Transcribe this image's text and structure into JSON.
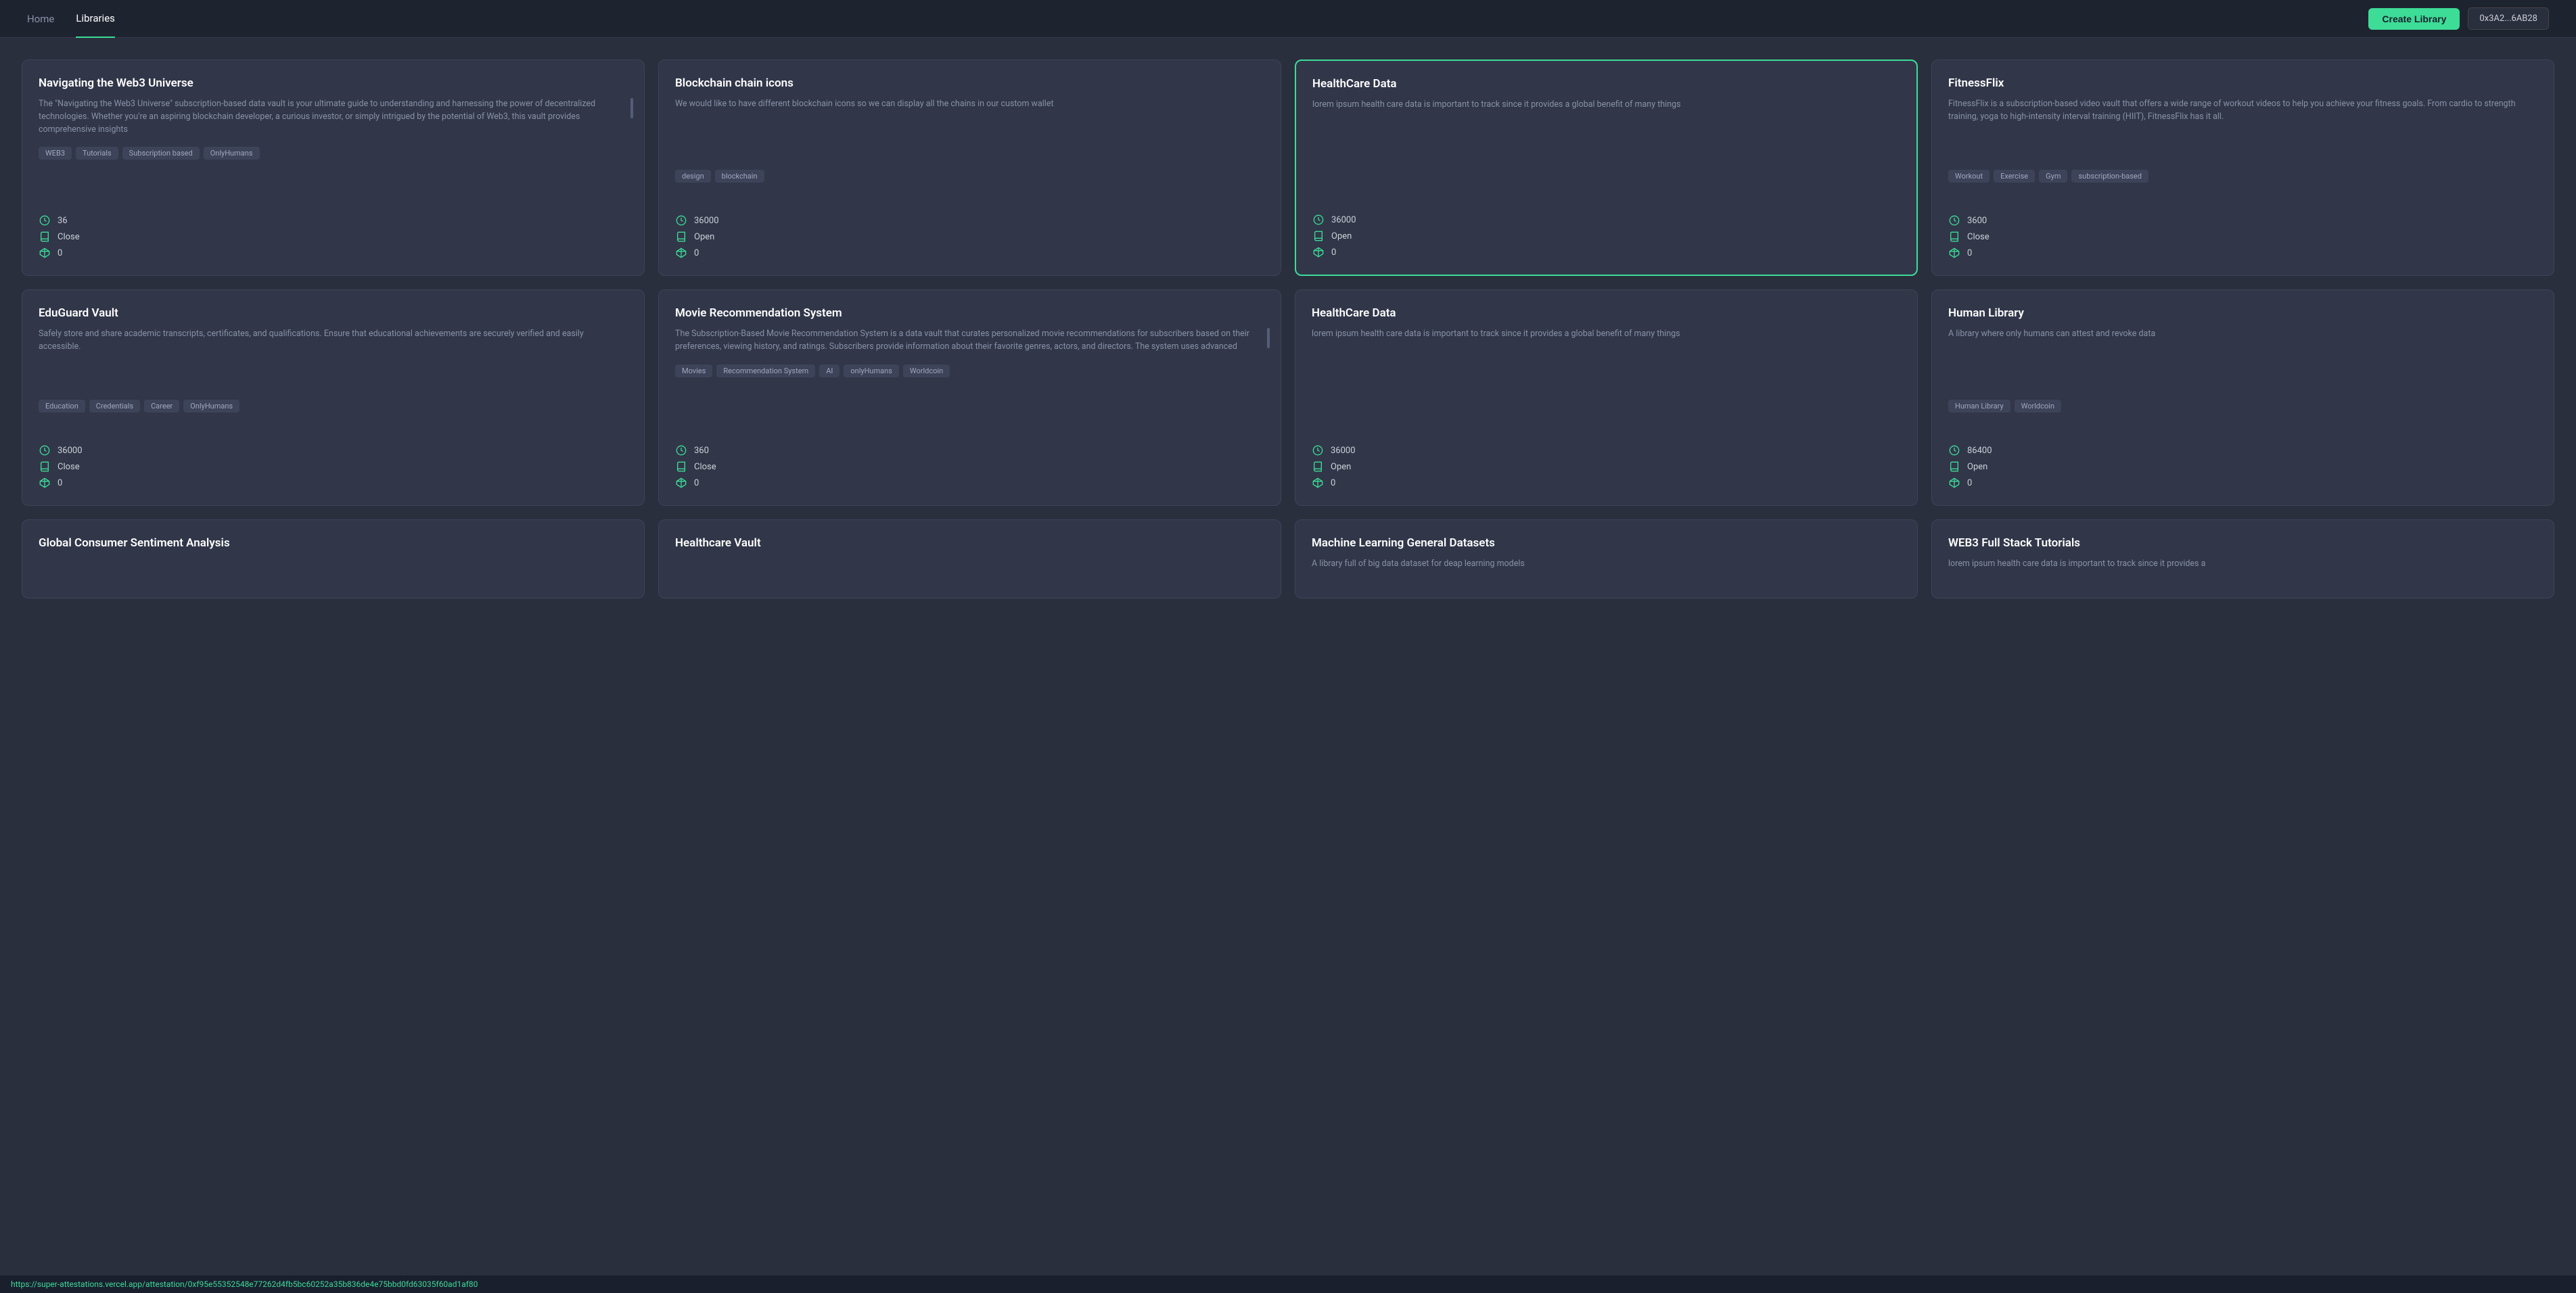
{
  "header": {
    "nav": [
      {
        "label": "Home",
        "active": false
      },
      {
        "label": "Libraries",
        "active": true
      }
    ],
    "create_library_label": "Create Library",
    "wallet_address": "0x3A2...6AB28"
  },
  "cards": [
    {
      "title": "Navigating the Web3 Universe",
      "description": "The \"Navigating the Web3 Universe\" subscription-based data vault is your ultimate guide to understanding and harnessing the power of decentralized technologies. Whether you're an aspiring blockchain developer, a curious investor, or simply intrigued by the potential of Web3, this vault provides comprehensive insights",
      "tags": [
        "WEB3",
        "Tutorials",
        "Subscription based",
        "OnlyHumans"
      ],
      "stats": {
        "count": "36",
        "access": "Close",
        "diamonds": "0"
      },
      "highlighted": false,
      "has_scroll": true
    },
    {
      "title": "Blockchain chain icons",
      "description": "We would like to have different blockchain icons so we can display all the chains in our custom wallet",
      "tags": [
        "design",
        "blockchain"
      ],
      "stats": {
        "count": "36000",
        "access": "Open",
        "diamonds": "0"
      },
      "highlighted": false,
      "has_scroll": false
    },
    {
      "title": "HealthCare Data",
      "description": "lorem ipsum health care data is important to track since it provides a global benefit of many things",
      "tags": [],
      "stats": {
        "count": "36000",
        "access": "Open",
        "diamonds": "0"
      },
      "highlighted": true,
      "has_scroll": false
    },
    {
      "title": "FitnessFlix",
      "description": "FitnessFlix is a subscription-based video vault that offers a wide range of workout videos to help you achieve your fitness goals. From cardio to strength training, yoga to high-intensity interval training (HIIT), FitnessFlix has it all.",
      "tags": [
        "Workout",
        "Exercise",
        "Gym",
        "subscription-based"
      ],
      "stats": {
        "count": "3600",
        "access": "Close",
        "diamonds": "0"
      },
      "highlighted": false,
      "has_scroll": false
    },
    {
      "title": "EduGuard Vault",
      "description": "Safely store and share academic transcripts, certificates, and qualifications. Ensure that educational achievements are securely verified and easily accessible.",
      "tags": [
        "Education",
        "Credentials",
        "Career",
        "OnlyHumans"
      ],
      "stats": {
        "count": "36000",
        "access": "Close",
        "diamonds": "0"
      },
      "highlighted": false,
      "has_scroll": false
    },
    {
      "title": "Movie Recommendation System",
      "description": "The Subscription-Based Movie Recommendation System is a data vault that curates personalized movie recommendations for subscribers based on their preferences, viewing history, and ratings. Subscribers provide information about their favorite genres, actors, and directors. The system uses advanced",
      "tags": [
        "Movies",
        "Recommendation System",
        "AI",
        "onlyHumans",
        "Worldcoin"
      ],
      "stats": {
        "count": "360",
        "access": "Close",
        "diamonds": "0"
      },
      "highlighted": false,
      "has_scroll": true
    },
    {
      "title": "HealthCare Data",
      "description": "lorem ipsum health care data is important to track since it provides a global benefit of many things",
      "tags": [],
      "stats": {
        "count": "36000",
        "access": "Open",
        "diamonds": "0"
      },
      "highlighted": false,
      "has_scroll": false
    },
    {
      "title": "Human Library",
      "description": "A library where only humans can attest and revoke data",
      "tags": [
        "Human Library",
        "Worldcoin"
      ],
      "stats": {
        "count": "86400",
        "access": "Open",
        "diamonds": "0"
      },
      "highlighted": false,
      "has_scroll": false
    },
    {
      "title": "Global Consumer Sentiment Analysis",
      "description": "",
      "tags": [],
      "stats": {
        "count": "",
        "access": "",
        "diamonds": ""
      },
      "highlighted": false,
      "has_scroll": false,
      "partial": true
    },
    {
      "title": "Healthcare Vault",
      "description": "",
      "tags": [],
      "stats": {
        "count": "",
        "access": "",
        "diamonds": ""
      },
      "highlighted": false,
      "has_scroll": false,
      "partial": true
    },
    {
      "title": "Machine Learning General Datasets",
      "description": "A library full of big data dataset for deap learning models",
      "tags": [],
      "stats": {
        "count": "",
        "access": "",
        "diamonds": ""
      },
      "highlighted": false,
      "has_scroll": false,
      "partial": true
    },
    {
      "title": "WEB3 Full Stack Tutorials",
      "description": "lorem ipsum health care data is important to track since it provides a",
      "tags": [],
      "stats": {
        "count": "",
        "access": "",
        "diamonds": ""
      },
      "highlighted": false,
      "has_scroll": false,
      "partial": true
    }
  ],
  "footer": {
    "url": "https://super-attestations.vercel.app/attestation/0xf95e55352548e77262d4fb5bc60252a35b836de4e75bbd0fd63035f60ad1af80"
  }
}
